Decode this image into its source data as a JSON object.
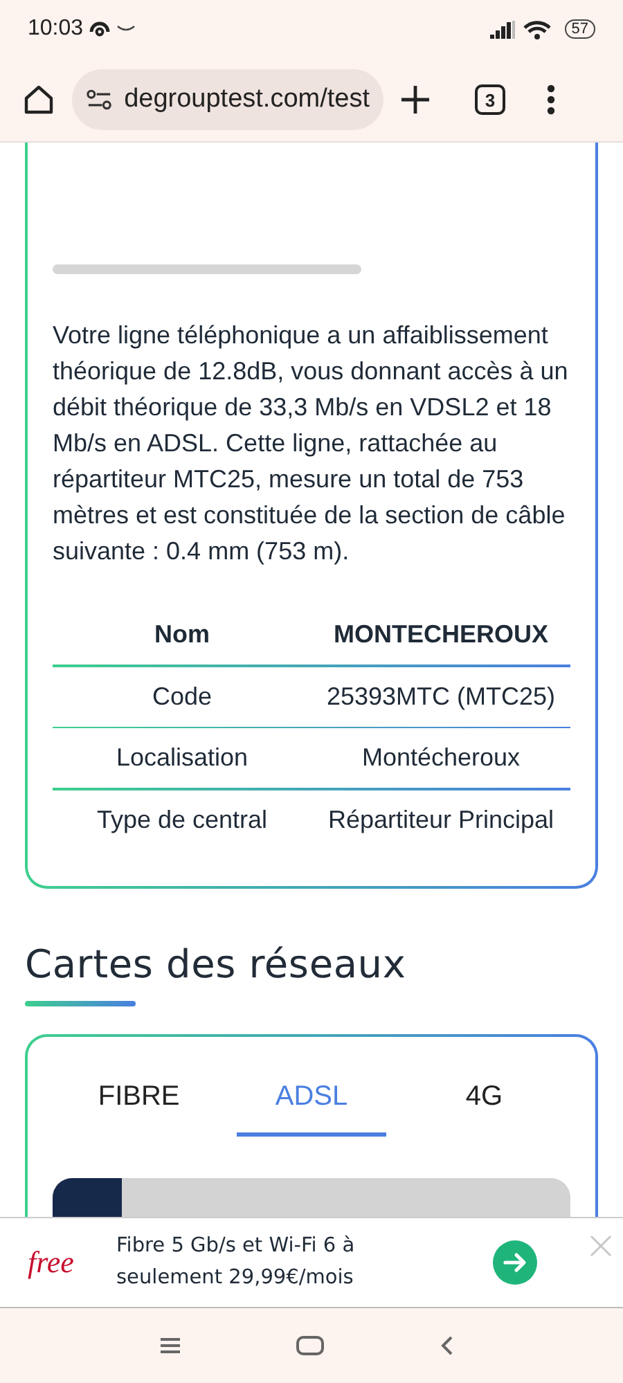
{
  "status_bar": {
    "time": "10:03",
    "battery": "57"
  },
  "browser": {
    "url": "degrouptest.com/test",
    "tab_count": "3"
  },
  "line_card": {
    "description": "Votre ligne téléphonique a un affaiblissement théorique de 12.8dB, vous donnant accès à un débit théorique de 33,3 Mb/s en VDSL2 et 18 Mb/s en ADSL. Cette ligne, rattachée au répartiteur MTC25, mesure un total de 753 mètres et est constituée de la section de câble suivante : 0.4 mm (753 m).",
    "table": {
      "header": [
        "Nom",
        "MONTECHEROUX"
      ],
      "rows": [
        [
          "Code",
          "25393MTC (MTC25)"
        ],
        [
          "Localisation",
          "Montécheroux"
        ],
        [
          "Type de central",
          "Répartiteur Principal"
        ]
      ]
    }
  },
  "maps": {
    "title": "Cartes des réseaux",
    "tabs": [
      {
        "label": "FIBRE",
        "selected": false
      },
      {
        "label": "ADSL",
        "selected": true
      },
      {
        "label": "4G",
        "selected": false
      }
    ]
  },
  "ad": {
    "brand": "free",
    "text": "Fibre 5 Gb/s et Wi-Fi 6 à seulement 29,99€/mois"
  }
}
